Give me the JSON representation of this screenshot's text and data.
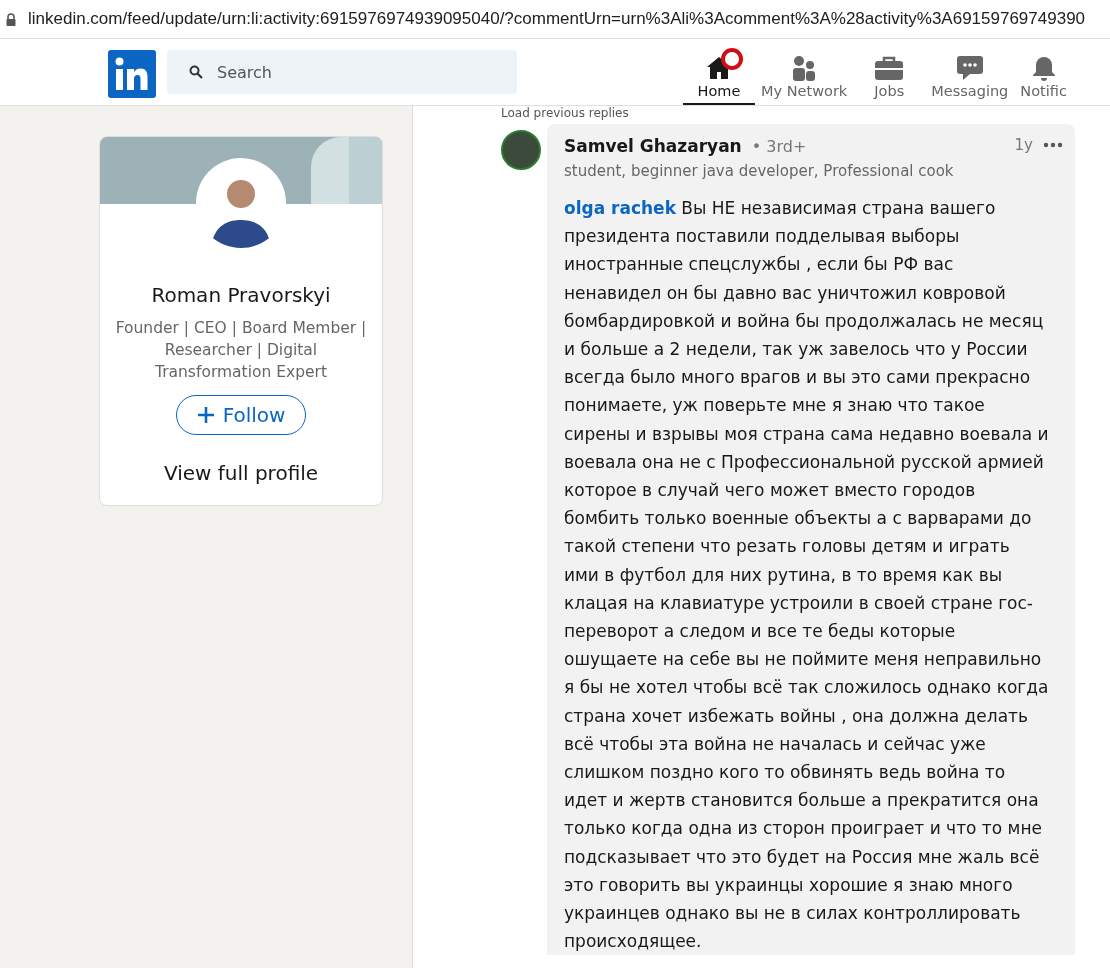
{
  "address_bar": {
    "url": "linkedin.com/feed/update/urn:li:activity:6915976974939095040/?commentUrn=urn%3Ali%3Acomment%3A%28activity%3A69159769749390"
  },
  "header": {
    "search": {
      "placeholder": "Search"
    },
    "nav": [
      {
        "label": "Home",
        "selected": true,
        "badge": true,
        "kind": "home"
      },
      {
        "label": "My Network",
        "selected": false,
        "badge": false,
        "kind": "network"
      },
      {
        "label": "Jobs",
        "selected": false,
        "badge": false,
        "kind": "jobs"
      },
      {
        "label": "Messaging",
        "selected": false,
        "badge": false,
        "kind": "messaging"
      },
      {
        "label": "Notific",
        "selected": false,
        "badge": false,
        "kind": "notifications"
      }
    ]
  },
  "profile_card": {
    "name": "Roman Pravorskyi",
    "headline": "Founder | CEO | Board Member | Researcher | Digital Transformation Expert",
    "follow": "Follow",
    "view_profile": "View full profile"
  },
  "thread": {
    "load_previous": "Load previous replies",
    "comment": {
      "author": "Samvel Ghazaryan",
      "degree": "• 3rd+",
      "subtitle": "student, beginner java developer, Professional cook",
      "time": "1y",
      "mention": "olga rachek",
      "text": "Вы НЕ независимая страна вашего президента поставили подделывая выборы иностранные спецслужбы , если бы РФ вас ненавидел он бы давно вас уничтожил ковровой бомбардировкой и война бы продолжалась не месяц и больше а 2 недели, так уж завелось что у России всегда было много врагов и вы это сами прекрасно понимаете, уж поверьте мне я знаю что такое сирены и взрывы моя страна сама недавно воевала и воевала она не с Профессиональной русской армией которое в случай чего может вместо городов бомбить только военные объекты а с варварами до такой степени что резать головы детям и играть ими в футбол для них рутина, в то время как вы клацая на клавиатуре устроили в своей стране гос-переворот а следом и все те беды которые ошущаете на себе вы не поймите меня неправильно я бы не хотел чтобы всё так сложилось однако когда страна хочет избежать войны , она должна делать всё чтобы эта война не началась и сейчас уже слишком поздно кого то обвинять ведь война то идет и жертв становится больше а прекратится она только когда одна из сторон проиграет и что то мне подсказывает что это будет на Россия мне жаль всё это говорить вы украинцы хорошие я знаю много украинцев однако вы не в силах контроллировать происходящее."
    }
  }
}
